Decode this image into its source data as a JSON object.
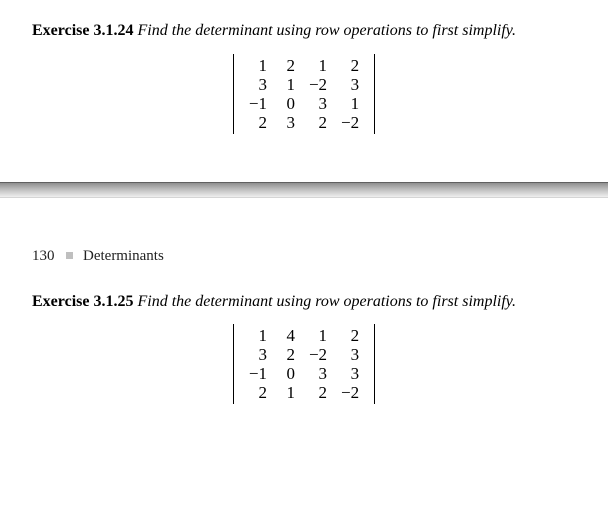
{
  "exercise1": {
    "label": "Exercise 3.1.24",
    "prompt": "Find the determinant using row operations to first simplify.",
    "matrix": {
      "r1c1": "1",
      "r1c2": "2",
      "r1c3": "1",
      "r1c4": "2",
      "r2c1": "3",
      "r2c2": "1",
      "r2c3": "−2",
      "r2c4": "3",
      "r3c1": "−1",
      "r3c2": "0",
      "r3c3": "3",
      "r3c4": "1",
      "r4c1": "2",
      "r4c2": "3",
      "r4c3": "2",
      "r4c4": "−2"
    }
  },
  "runningHead": {
    "pageNumber": "130",
    "section": "Determinants"
  },
  "exercise2": {
    "label": "Exercise 3.1.25",
    "prompt": "Find the determinant using row operations to first simplify.",
    "matrix": {
      "r1c1": "1",
      "r1c2": "4",
      "r1c3": "1",
      "r1c4": "2",
      "r2c1": "3",
      "r2c2": "2",
      "r2c3": "−2",
      "r2c4": "3",
      "r3c1": "−1",
      "r3c2": "0",
      "r3c3": "3",
      "r3c4": "3",
      "r4c1": "2",
      "r4c2": "1",
      "r4c3": "2",
      "r4c4": "−2"
    }
  }
}
